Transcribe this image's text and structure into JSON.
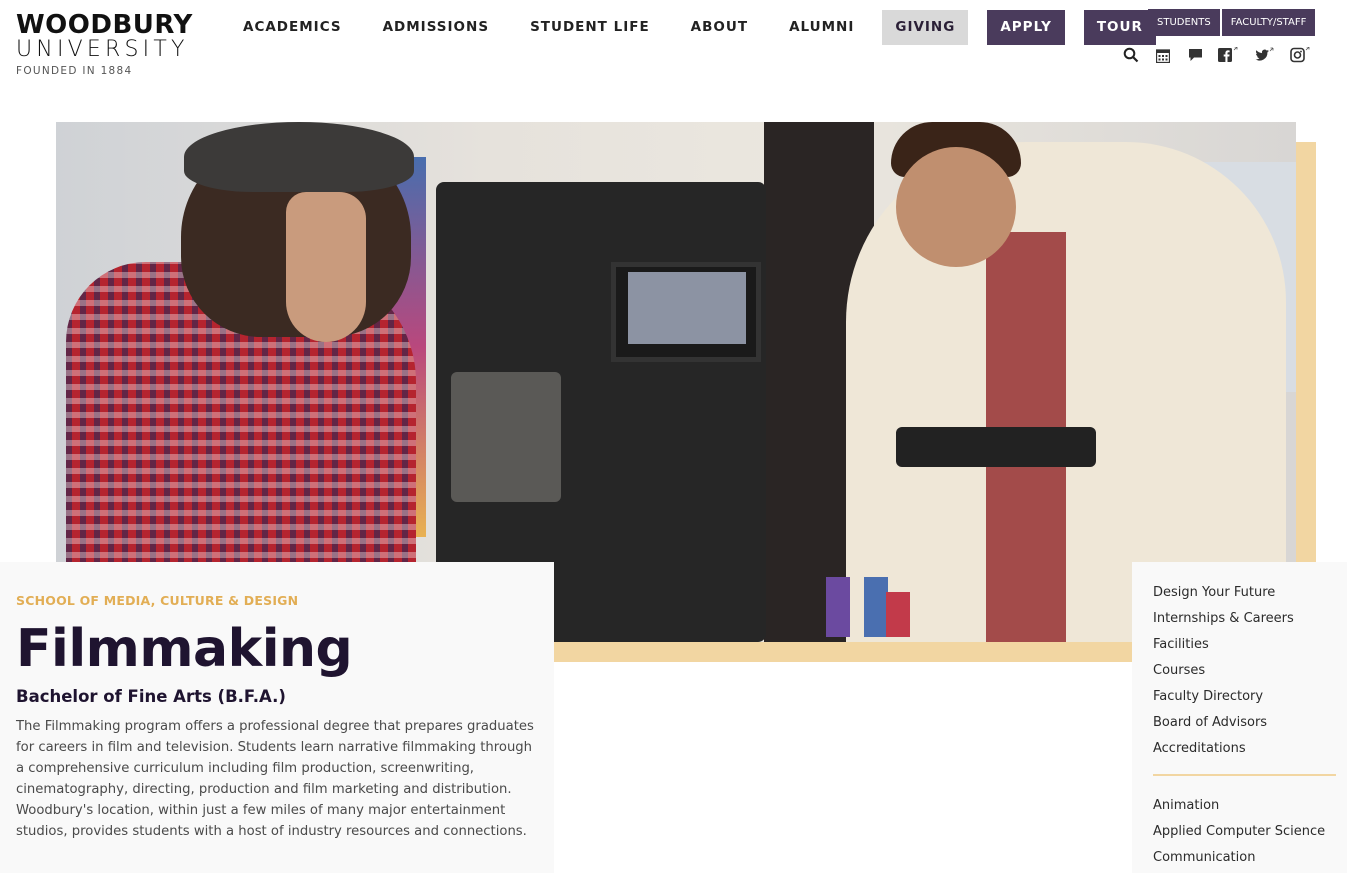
{
  "logo": {
    "line1": "WOODBURY",
    "line2": "UNIVERSITY",
    "line3": "FOUNDED IN 1884"
  },
  "nav": {
    "items": [
      "ACADEMICS",
      "ADMISSIONS",
      "STUDENT LIFE",
      "ABOUT",
      "ALUMNI"
    ],
    "giving": "GIVING",
    "apply": "APPLY",
    "tour": "TOUR"
  },
  "utility": {
    "students": "STUDENTS",
    "faculty_staff": "FACULTY/STAFF",
    "icons": [
      "search-icon",
      "calendar-icon",
      "chat-icon",
      "facebook-icon",
      "twitter-icon",
      "instagram-icon"
    ]
  },
  "program": {
    "school": "SCHOOL OF MEDIA, CULTURE & DESIGN",
    "title": "Filmmaking",
    "degree": "Bachelor of Fine Arts (B.F.A.)",
    "description": "The Filmmaking program offers a professional degree that prepares graduates for careers in film and television. Students learn narrative filmmaking through a comprehensive curriculum including film production, screenwriting, cinematography, directing, production and film marketing and distribution. Woodbury's location, within just a few miles of many major entertainment studios, provides students with a host of industry resources and connections."
  },
  "sidebar": {
    "program_links": [
      "Design Your Future",
      "Internships & Careers",
      "Facilities",
      "Courses",
      "Faculty Directory",
      "Board of Advisors",
      "Accreditations"
    ],
    "other_programs": [
      "Animation",
      "Applied Computer Science",
      "Communication"
    ]
  },
  "colors": {
    "brand_purple": "#4a3b5c",
    "accent_gold": "#f2d6a2",
    "school_label": "#e2ae55",
    "title_dark": "#1f1430"
  }
}
